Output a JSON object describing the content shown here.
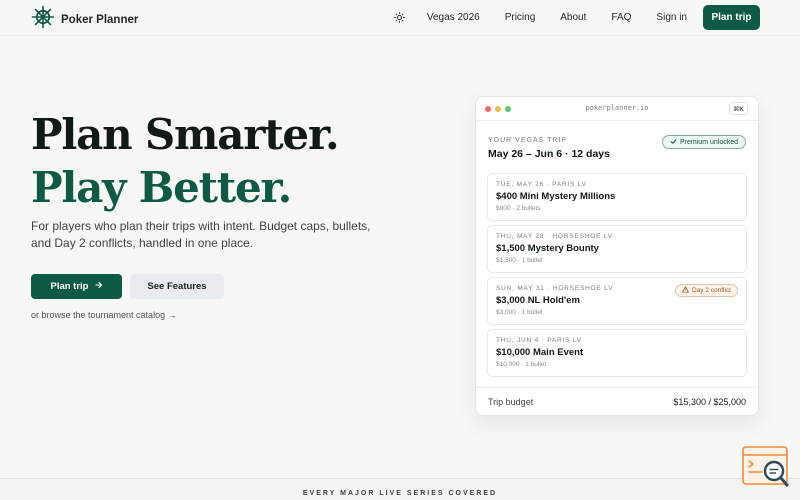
{
  "nav": {
    "brand": "Poker Planner",
    "links": [
      "Vegas 2026",
      "Pricing",
      "About",
      "FAQ",
      "Sign in"
    ],
    "cta": "Plan trip"
  },
  "hero": {
    "title_line1": "Plan Smarter.",
    "title_line2": "Play Better.",
    "subtitle": "For players who plan their trips with intent. Budget caps, bullets, and Day 2 conflicts, handled in one place.",
    "primary_button": "Plan trip",
    "secondary_button": "See Features",
    "browse_link": "or browse the tournament catalog →"
  },
  "card": {
    "url": "pokerplanner.io",
    "shortcut": "⌘K",
    "trip_label": "YOUR VEGAS TRIP",
    "trip_dates": "May 26 – Jun 6 · 12 days",
    "premium_badge": "Premium unlocked",
    "events": [
      {
        "meta": "TUE, MAY 26 · PARIS LV",
        "name": "$400 Mini Mystery Millions",
        "detail": "$800 · 2 bullets",
        "badge": ""
      },
      {
        "meta": "THU, MAY 28 · HORSESHOE LV",
        "name": "$1,500 Mystery Bounty",
        "detail": "$1,500 · 1 bullet",
        "badge": ""
      },
      {
        "meta": "SUN, MAY 31 · HORSESHOE LV",
        "name": "$3,000 NL Hold'em",
        "detail": "$3,000 · 1 bullet",
        "badge": "Day 2 conflict"
      },
      {
        "meta": "THU, JUN 4 · PARIS LV",
        "name": "$10,000 Main Event",
        "detail": "$10,000 · 1 bullet",
        "badge": ""
      }
    ],
    "budget_label": "Trip budget",
    "budget_value": "$15,300 / $25,000"
  },
  "footer_band": {
    "text": "EVERY MAJOR LIVE SERIES COVERED"
  },
  "colors": {
    "brand_green": "#0f5a44",
    "background": "#f7f8f6",
    "warning": "#a25b22"
  },
  "icons": [
    "ship-wheel-icon",
    "sun-icon",
    "arrow-right-icon",
    "check-icon",
    "warning-icon",
    "search-code-icon"
  ]
}
